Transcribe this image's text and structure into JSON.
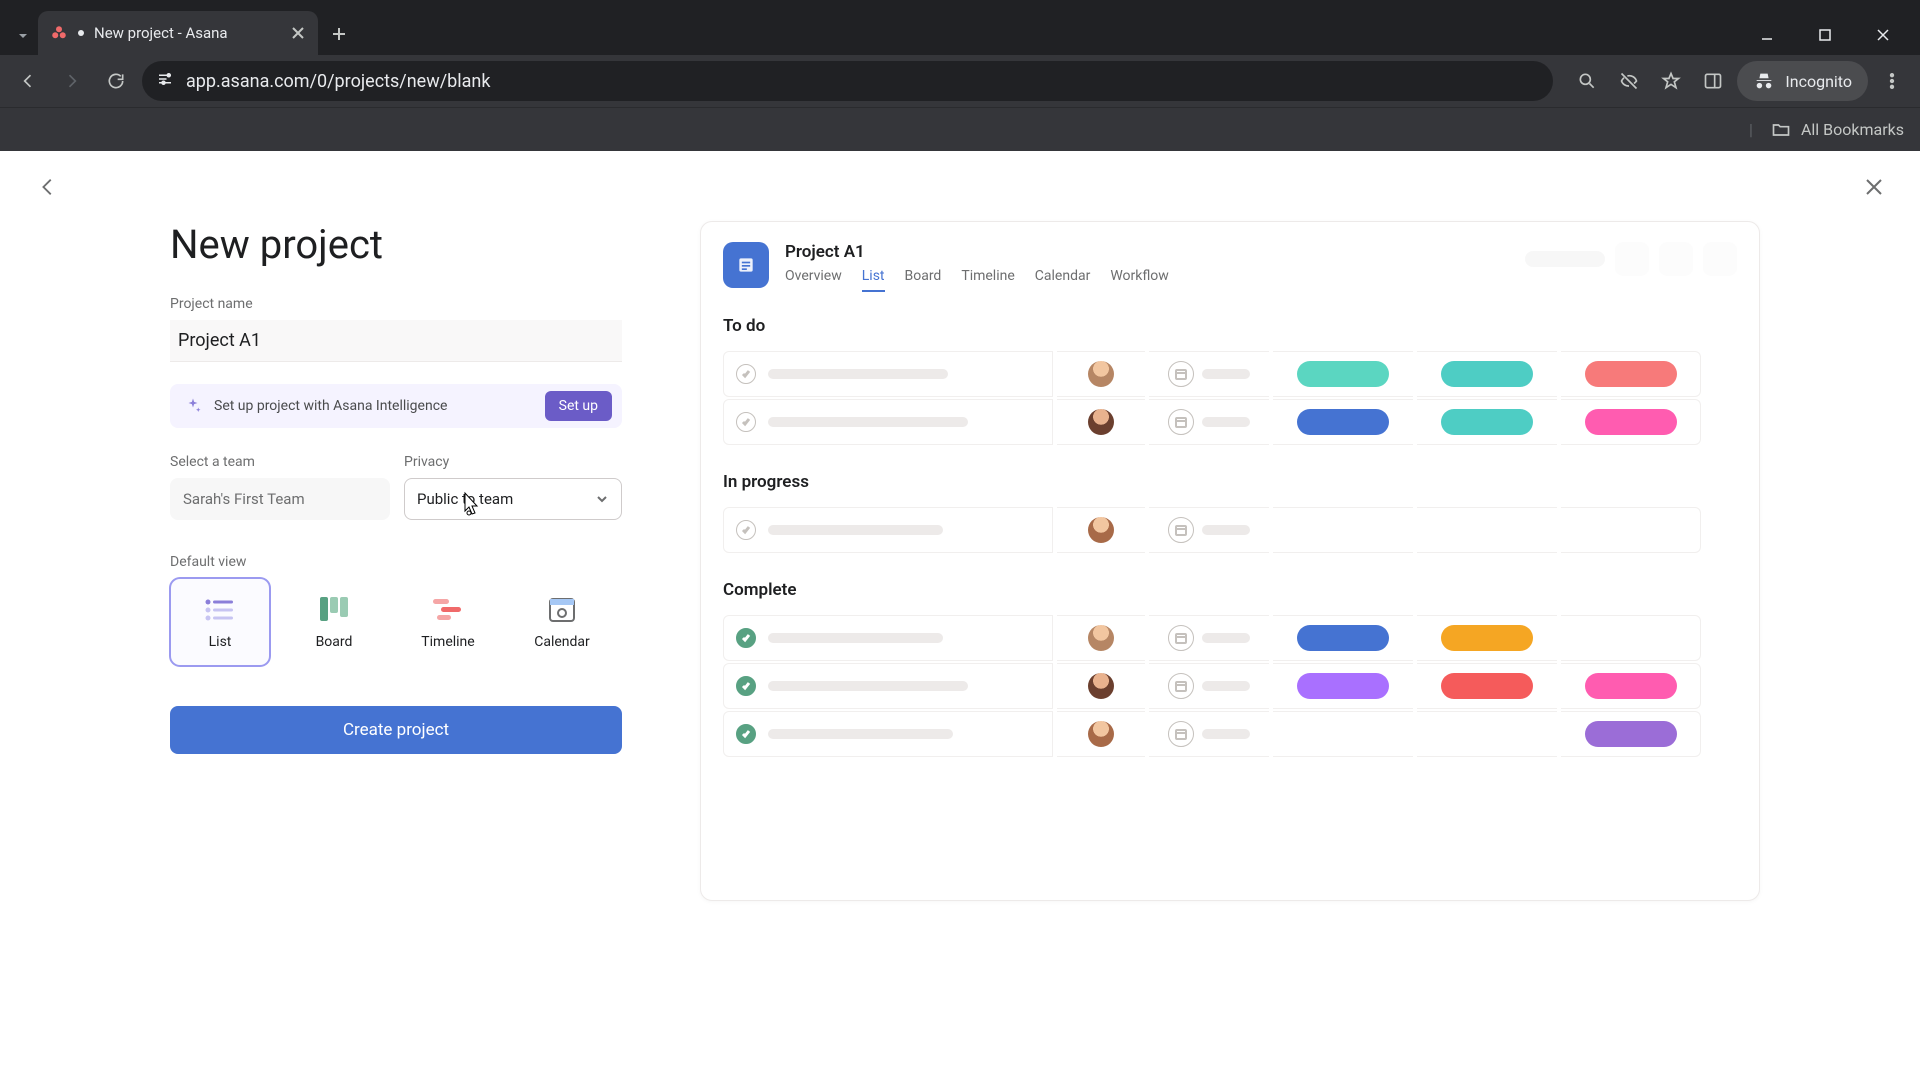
{
  "browser": {
    "tab_title": "New project - Asana",
    "url": "app.asana.com/0/projects/new/blank",
    "incognito_label": "Incognito",
    "all_bookmarks": "All Bookmarks"
  },
  "form": {
    "heading": "New project",
    "project_name_label": "Project name",
    "project_name_value": "Project A1",
    "ai_text": "Set up project with Asana Intelligence",
    "setup_btn": "Set up",
    "team_label": "Select a team",
    "team_value": "Sarah's First Team",
    "privacy_label": "Privacy",
    "privacy_value": "Public to team",
    "default_view_label": "Default view",
    "views": {
      "list": "List",
      "board": "Board",
      "timeline": "Timeline",
      "calendar": "Calendar"
    },
    "create_btn": "Create project"
  },
  "preview": {
    "title": "Project A1",
    "tabs": [
      "Overview",
      "List",
      "Board",
      "Timeline",
      "Calendar",
      "Workflow"
    ],
    "active_tab": "List",
    "sections": {
      "todo": "To do",
      "in_progress": "In progress",
      "complete": "Complete"
    },
    "tag_colors": {
      "teal": "#5bd6c1",
      "blue": "#4573d2",
      "green": "#4ecdc4",
      "pink": "#f06292",
      "coral": "#f77a7a",
      "orange": "#f5a623",
      "purple": "#a970ff",
      "red": "#f55b5b",
      "magenta": "#ff5cb0",
      "violet": "#9b6dd7"
    }
  }
}
